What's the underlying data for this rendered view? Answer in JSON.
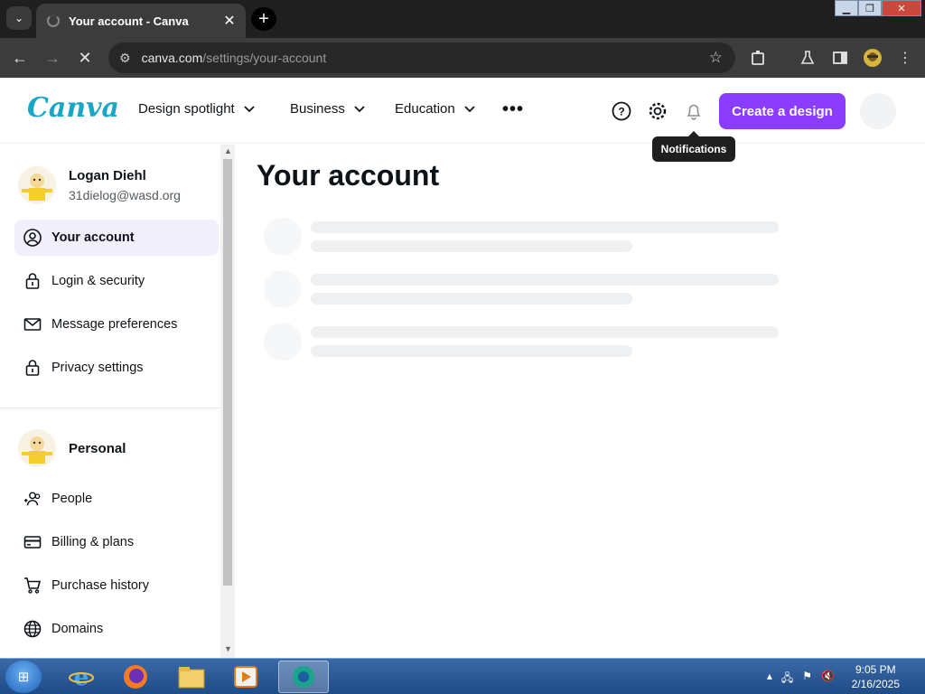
{
  "browser": {
    "tab_title": "Your account - Canva",
    "tab_close": "✕",
    "new_tab": "+",
    "url_host": "canva.com",
    "url_path": "/settings/your-account"
  },
  "header": {
    "logo": "Canva",
    "nav": [
      "Design spotlight",
      "Business",
      "Education"
    ],
    "more": "•••",
    "create_label": "Create a design",
    "tooltip": "Notifications"
  },
  "sidebar": {
    "user_name": "Logan Diehl",
    "user_email": "31dielog@wasd.org",
    "account_items": [
      {
        "label": "Your account",
        "icon": "user-circle-icon"
      },
      {
        "label": "Login & security",
        "icon": "lock-icon"
      },
      {
        "label": "Message preferences",
        "icon": "envelope-icon"
      },
      {
        "label": "Privacy settings",
        "icon": "lock-icon"
      }
    ],
    "team_name": "Personal",
    "team_items": [
      {
        "label": "People",
        "icon": "people-add-icon"
      },
      {
        "label": "Billing & plans",
        "icon": "credit-card-icon"
      },
      {
        "label": "Purchase history",
        "icon": "cart-icon"
      },
      {
        "label": "Domains",
        "icon": "globe-icon"
      }
    ]
  },
  "main": {
    "title": "Your account"
  },
  "taskbar": {
    "time": "9:05 PM",
    "date": "2/16/2025"
  },
  "colors": {
    "accent": "#8b3dff",
    "logo": "#18a7c8",
    "active_item_bg": "#f2effc"
  }
}
